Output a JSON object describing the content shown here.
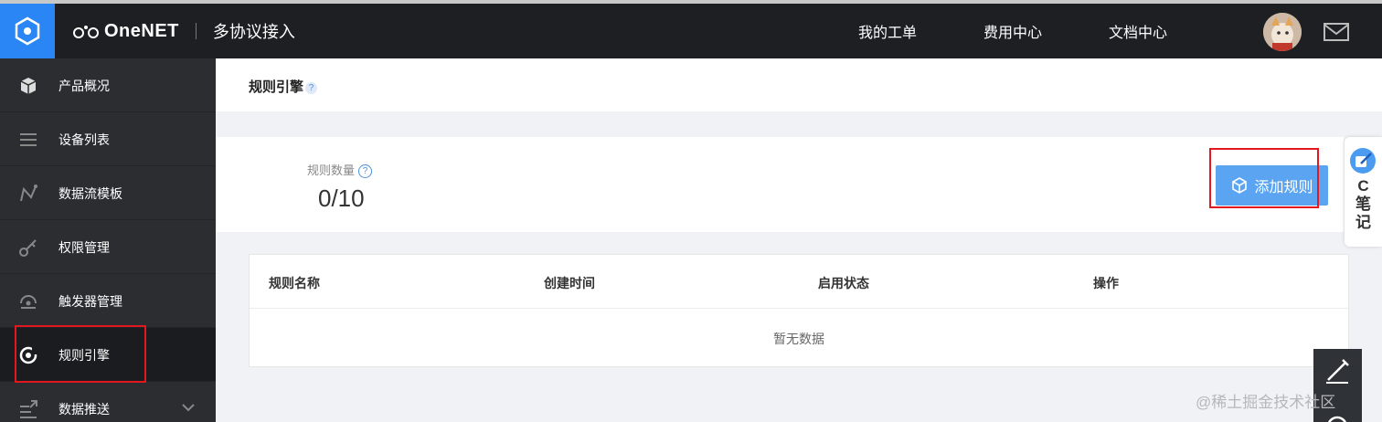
{
  "header": {
    "brand_name": "OneNET",
    "product_name": "多协议接入",
    "nav": [
      "我的工单",
      "费用中心",
      "文档中心"
    ]
  },
  "sidebar": {
    "items": [
      {
        "label": "产品概况",
        "icon": "cube-icon"
      },
      {
        "label": "设备列表",
        "icon": "list-icon"
      },
      {
        "label": "数据流模板",
        "icon": "stream-icon"
      },
      {
        "label": "权限管理",
        "icon": "key-icon"
      },
      {
        "label": "触发器管理",
        "icon": "trigger-icon"
      },
      {
        "label": "规则引擎",
        "icon": "rule-engine-icon",
        "active": true
      },
      {
        "label": "数据推送",
        "icon": "push-icon"
      }
    ]
  },
  "page": {
    "title": "规则引擎",
    "help_mark": "?"
  },
  "stats": {
    "label": "规则数量",
    "help_mark": "?",
    "value": "0/10"
  },
  "actions": {
    "add_rule": "添加规则"
  },
  "table": {
    "columns": [
      "规则名称",
      "创建时间",
      "启用状态",
      "操作"
    ],
    "empty_text": "暂无数据"
  },
  "floating": {
    "note_c": "C",
    "note_label": "笔记"
  },
  "watermark": "@稀土掘金技术社区",
  "colors": {
    "topbar": "#1d1f22",
    "logo_bg": "#2b86f5",
    "sidebar": "#2b2d31",
    "primary_button": "#5ba4f2",
    "highlight_box": "#e3171f"
  }
}
